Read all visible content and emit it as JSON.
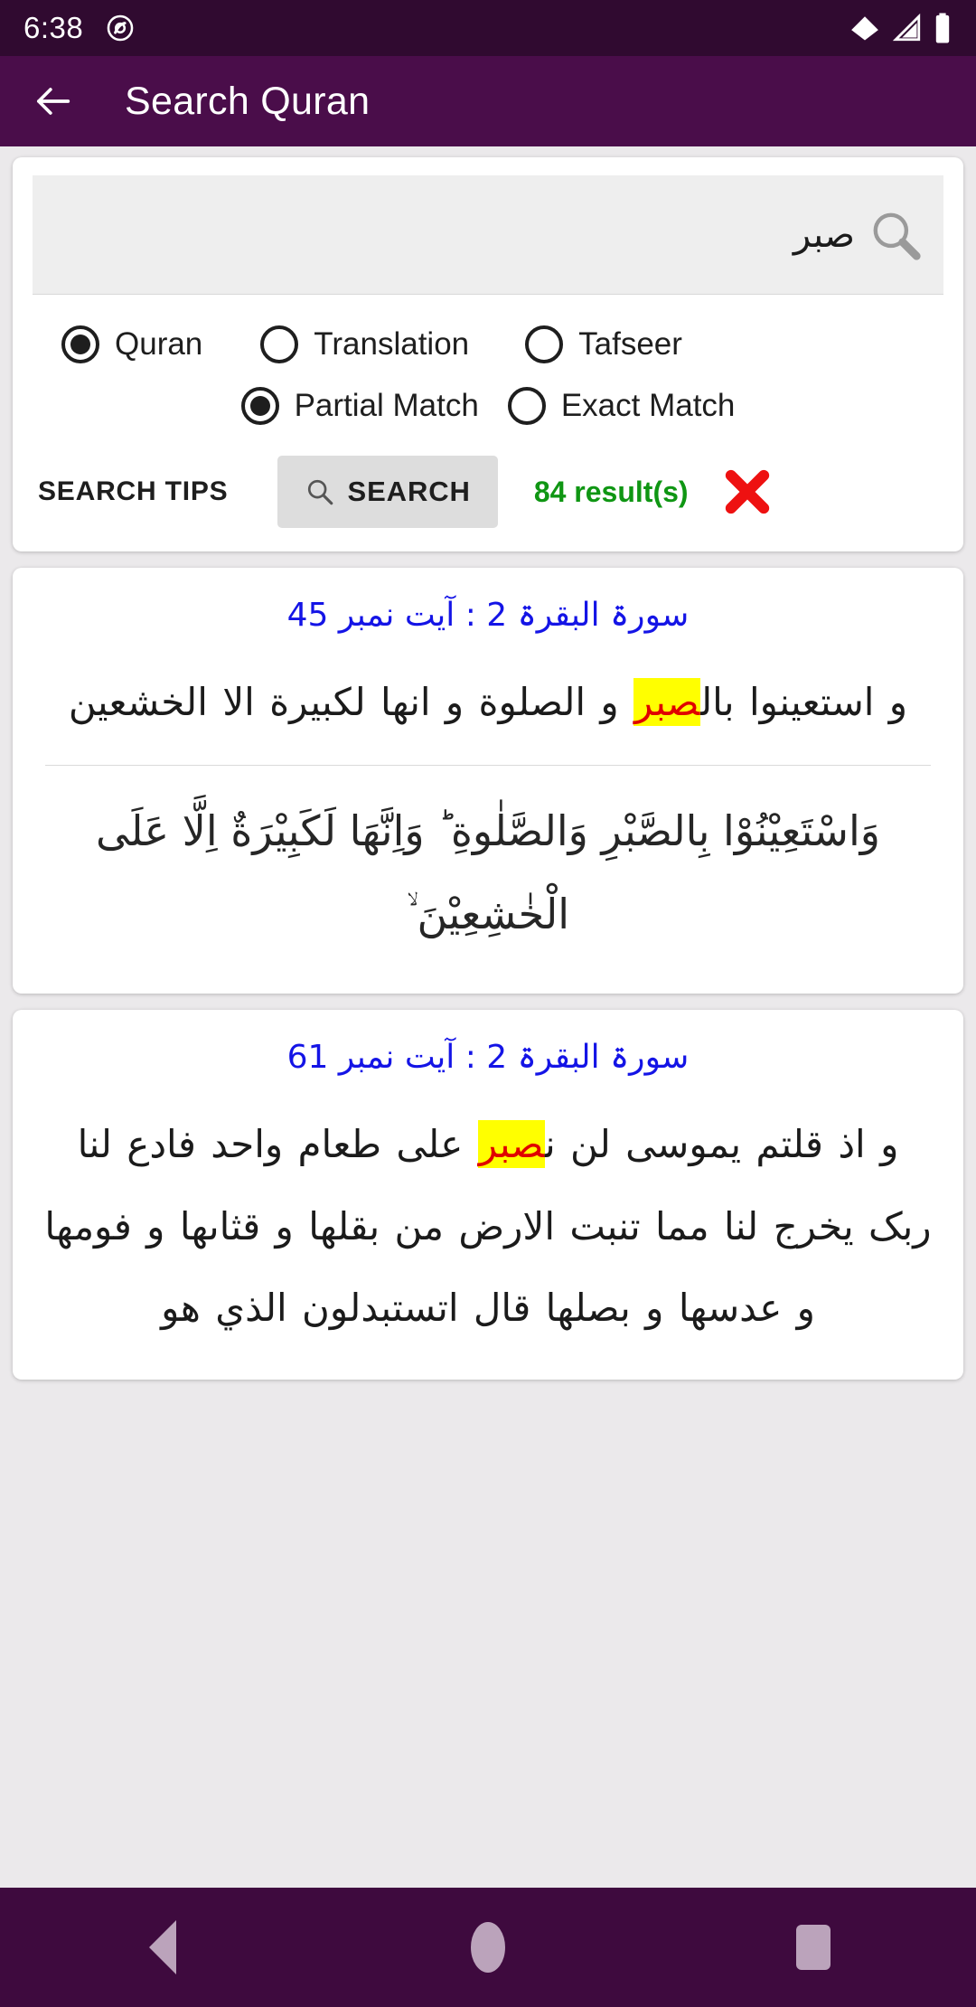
{
  "status_bar": {
    "time": "6:38",
    "icons": [
      "app-notification-icon",
      "wifi-icon",
      "signal-icon",
      "battery-icon"
    ]
  },
  "app_bar": {
    "back_icon": "arrow-left-icon",
    "title": "Search Quran"
  },
  "search_panel": {
    "input": {
      "value": "صبر",
      "placeholder": "",
      "icon": "magnifier-icon"
    },
    "source_options": [
      {
        "label": "Quran",
        "selected": true
      },
      {
        "label": "Translation",
        "selected": false
      },
      {
        "label": "Tafseer",
        "selected": false
      }
    ],
    "match_options": [
      {
        "label": "Partial Match",
        "selected": true
      },
      {
        "label": "Exact Match",
        "selected": false
      }
    ],
    "search_tips_label": "SEARCH TIPS",
    "search_button_label": "SEARCH",
    "result_count_text": "84 result(s)",
    "clear_icon": "close-x-icon",
    "result_count_color": "#0f9613",
    "clear_icon_color": "#ee1111"
  },
  "results": [
    {
      "reference": "سورۃ البقرۃ 2 : آیت نمبر 45",
      "urdu_before": "و استعينوا بال",
      "urdu_highlight": "صبر",
      "urdu_after": " و الصلوة و انها لكبيرة الا الخشعين",
      "arabic": "وَاسْتَعِيْنُوْا بِالصَّبْرِ وَالصَّلٰوةِ ؕ وَاِنَّهَا لَكَبِيْرَةٌ اِلَّا عَلَى الْخٰشِعِيْنَ ۙ"
    },
    {
      "reference": "سورۃ البقرۃ 2 : آیت نمبر 61",
      "urdu_before": "و اذ قلتم يموسى لن ن",
      "urdu_highlight": "صبر",
      "urdu_after": " على طعام واحد فادع لنا ربک يخرج لنا مما تنبت الارض من بقلها و قثاىها و فومها و عدسها و بصلها قال اتستبدلون الذي هو",
      "arabic": ""
    }
  ],
  "nav_bar": {
    "back_label": "back-button",
    "home_label": "home-button",
    "recents_label": "recents-button"
  },
  "colors": {
    "status_bar": "#300A30",
    "app_bar": "#4A0D4A",
    "nav_bar": "#3E0A3E",
    "page_bg": "#ebe9eb",
    "reference_blue": "#1414e6",
    "highlight_yellow": "#ffff00",
    "highlight_red": "#e00000"
  }
}
